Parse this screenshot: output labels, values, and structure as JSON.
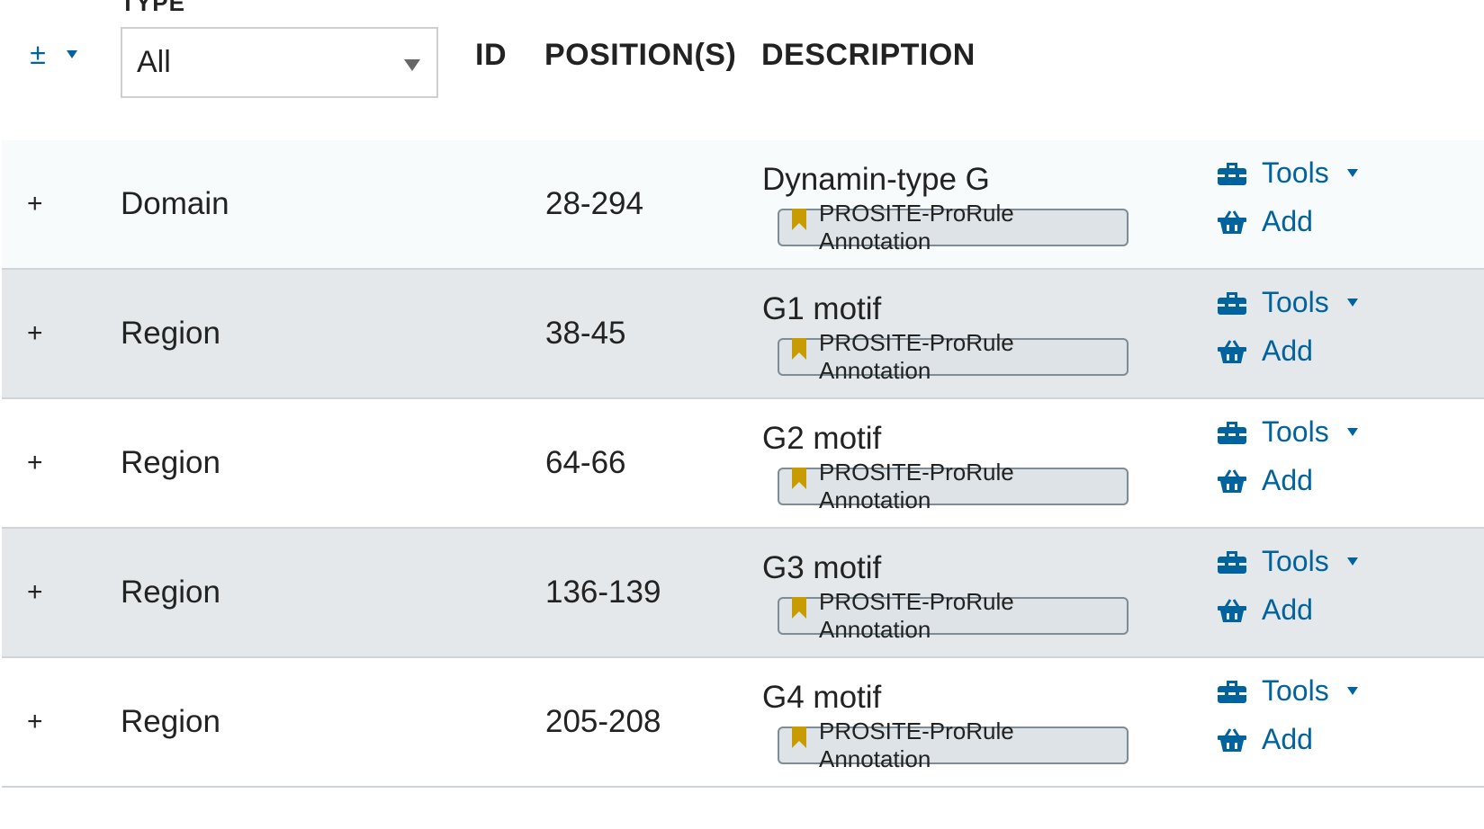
{
  "header": {
    "type_label": "TYPE",
    "type_select_value": "All",
    "col_id": "ID",
    "col_positions": "POSITION(S)",
    "col_description": "DESCRIPTION"
  },
  "rows": [
    {
      "expand": "+",
      "type": "Domain",
      "positions": "28-294",
      "description": "Dynamin-type G",
      "evidence": "PROSITE-ProRule Annotation",
      "tools": "Tools",
      "add": "Add"
    },
    {
      "expand": "+",
      "type": "Region",
      "positions": "38-45",
      "description": "G1 motif",
      "evidence": "PROSITE-ProRule Annotation",
      "tools": "Tools",
      "add": "Add"
    },
    {
      "expand": "+",
      "type": "Region",
      "positions": "64-66",
      "description": "G2 motif",
      "evidence": "PROSITE-ProRule Annotation",
      "tools": "Tools",
      "add": "Add"
    },
    {
      "expand": "+",
      "type": "Region",
      "positions": "136-139",
      "description": "G3 motif",
      "evidence": "PROSITE-ProRule Annotation",
      "tools": "Tools",
      "add": "Add"
    },
    {
      "expand": "+",
      "type": "Region",
      "positions": "205-208",
      "description": "G4 motif",
      "evidence": "PROSITE-ProRule Annotation",
      "tools": "Tools",
      "add": "Add"
    }
  ],
  "icons": {
    "expand_all": "plus-minus-icon",
    "tools": "toolbox-icon",
    "add": "basket-icon",
    "evidence": "bookmark-icon"
  },
  "colors": {
    "link": "#00639e",
    "evidence_bookmark": "#c89b00",
    "row_alt": "#e4e8ea"
  }
}
